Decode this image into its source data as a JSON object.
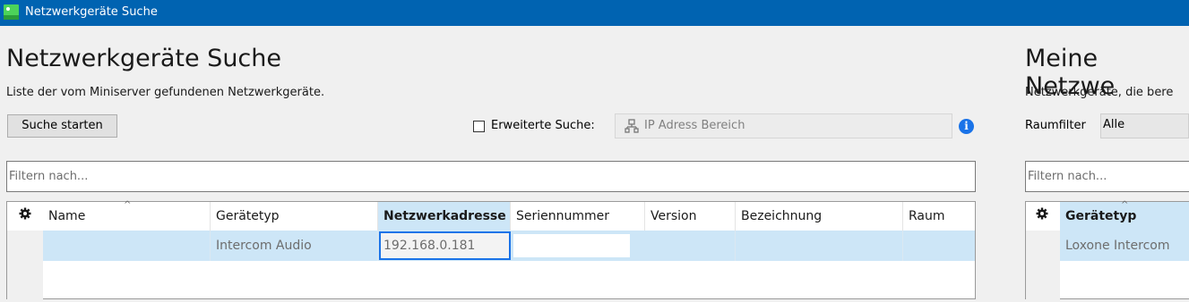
{
  "window": {
    "title": "Netzwerkgeräte Suche"
  },
  "left": {
    "heading": "Netzwerkgeräte Suche",
    "subtitle": "Liste der vom Miniserver gefundenen Netzwerkgeräte.",
    "search_button": "Suche starten",
    "extended_search_label": "Erweiterte Suche:",
    "extended_search_checked": false,
    "ip_range_placeholder": "IP Adress Bereich",
    "filter_placeholder": "Filtern nach...",
    "columns": [
      "Name",
      "Gerätetyp",
      "Netzwerkadresse",
      "Seriennummer",
      "Version",
      "Bezeichnung",
      "Raum"
    ],
    "sorted_column": "Netzwerkadresse",
    "rows": [
      {
        "name": "",
        "type": "Intercom Audio",
        "address": "192.168.0.181",
        "serial": "",
        "version": "",
        "label": "",
        "room": ""
      }
    ]
  },
  "right": {
    "heading": "Meine Netzwe",
    "subtitle": "Netzwerkgeräte, die bere",
    "room_filter_label": "Raumfilter",
    "room_filter_value": "Alle",
    "filter_placeholder": "Filtern nach...",
    "columns": [
      "Gerätetyp"
    ],
    "rows": [
      {
        "type": "Loxone Intercom"
      }
    ]
  },
  "colors": {
    "titlebar": "#0063b1",
    "selection": "#cde6f7",
    "info": "#1a73e8"
  },
  "icons": {
    "app": "app-icon",
    "network": "network-icon",
    "info": "info-icon",
    "settings": "gear-icon"
  }
}
